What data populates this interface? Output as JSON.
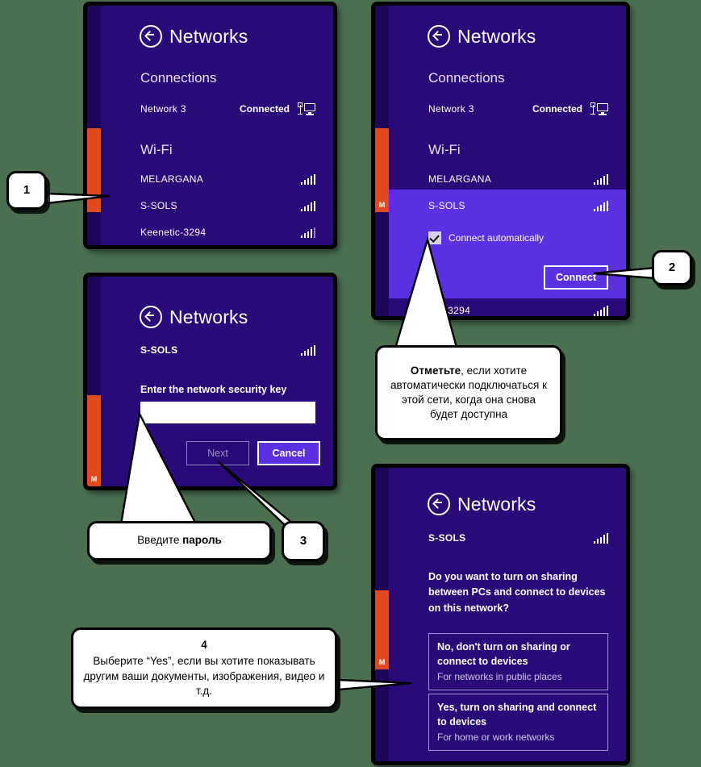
{
  "background_color": "#4a7050",
  "theme": {
    "panel_bg": "#2a0a78",
    "panel_edge": "#1e0559",
    "accent_orange": "#e14a1e",
    "selection_purple": "#5b30e0",
    "text_white": "#ffffff"
  },
  "panels": {
    "step1": {
      "header_title": "Networks",
      "back_icon": "back-arrow-icon",
      "connections_label": "Connections",
      "connection": {
        "name": "Network  3",
        "status": "Connected",
        "icon": "wired-monitor-icon"
      },
      "wifi_label": "Wi-Fi",
      "networks": [
        {
          "name": "MELARGANA",
          "icon": "signal-bars-icon",
          "strength": 5
        },
        {
          "name": "S-SOLS",
          "icon": "signal-bars-icon",
          "strength": 5
        },
        {
          "name": "Keenetic-3294",
          "icon": "signal-bars-icon",
          "strength": 4
        }
      ],
      "accent_letter": ""
    },
    "step2": {
      "header_title": "Networks",
      "back_icon": "back-arrow-icon",
      "connections_label": "Connections",
      "connection": {
        "name": "Network  3",
        "status": "Connected",
        "icon": "wired-monitor-icon"
      },
      "wifi_label": "Wi-Fi",
      "networks": [
        {
          "name": "MELARGANA",
          "icon": "signal-bars-icon",
          "strength": 5
        },
        {
          "name": "S-SOLS",
          "icon": "signal-bars-icon",
          "strength": 5,
          "selected": true
        },
        {
          "name": "etic-3294",
          "icon": "signal-bars-icon",
          "strength": 5
        }
      ],
      "checkbox_label": "Connect automatically",
      "checkbox_checked": true,
      "connect_button": "Connect",
      "accent_letter": "M"
    },
    "step3": {
      "header_title": "Networks",
      "back_icon": "back-arrow-icon",
      "network_name": "S-SOLS",
      "network_icon": "signal-bars-icon",
      "field_label": "Enter the network security key",
      "field_value": "",
      "field_placeholder": "",
      "next_button": "Next",
      "next_disabled": true,
      "cancel_button": "Cancel",
      "accent_letter": "M"
    },
    "step4": {
      "header_title": "Networks",
      "back_icon": "back-arrow-icon",
      "network_name": "S-SOLS",
      "network_icon": "signal-bars-icon",
      "question": "Do you want to turn on sharing between PCs and connect to devices on this network?",
      "choices": [
        {
          "title": "No, don't turn on sharing or connect to devices",
          "subtitle": "For networks in public places"
        },
        {
          "title": "Yes, turn on sharing and connect to devices",
          "subtitle": "For home or work networks"
        }
      ],
      "accent_letter": "M"
    }
  },
  "callouts": {
    "step_1_number": "1",
    "step_2_number": "2",
    "step_3_number": "3",
    "auto_connect": {
      "bold": "Отметьте",
      "rest": ", если хотите автоматически подключаться к этой сети, когда она снова будет доступна"
    },
    "password": {
      "plain": "Введите ",
      "bold": "пароль"
    },
    "sharing": {
      "number": "4",
      "text": "Выберите “Yes”, если вы хотите показывать другим ваши документы, изображения, видео и т.д."
    }
  }
}
